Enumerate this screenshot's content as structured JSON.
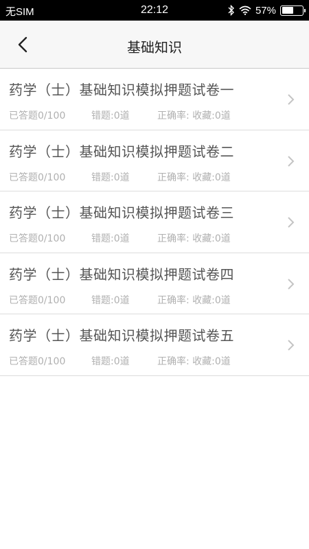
{
  "status_bar": {
    "carrier": "无SIM",
    "time": "22:12",
    "battery": "57%",
    "battery_level": 0.57,
    "icons": [
      "bluetooth-icon",
      "wifi-icon",
      "battery-icon"
    ]
  },
  "nav": {
    "title": "基础知识",
    "back_icon": "chevron-left-icon"
  },
  "papers": [
    {
      "name": "药学（士）基础知识模拟押题试卷一",
      "answered": "已答题0/100",
      "wrong": "错题:0道",
      "rate_fav": "正确率: 收藏:0道"
    },
    {
      "name": "药学（士）基础知识模拟押题试卷二",
      "answered": "已答题0/100",
      "wrong": "错题:0道",
      "rate_fav": "正确率: 收藏:0道"
    },
    {
      "name": "药学（士）基础知识模拟押题试卷三",
      "answered": "已答题0/100",
      "wrong": "错题:0道",
      "rate_fav": "正确率: 收藏:0道"
    },
    {
      "name": "药学（士）基础知识模拟押题试卷四",
      "answered": "已答题0/100",
      "wrong": "错题:0道",
      "rate_fav": "正确率: 收藏:0道"
    },
    {
      "name": "药学（士）基础知识模拟押题试卷五",
      "answered": "已答题0/100",
      "wrong": "错题:0道",
      "rate_fav": "正确率: 收藏:0道"
    }
  ],
  "colors": {
    "status_bar_bg": "#000000",
    "nav_bg": "#f7f7f7",
    "title_text": "#555555",
    "meta_text": "#b0b0b0",
    "chevron": "#c4c4c4"
  }
}
